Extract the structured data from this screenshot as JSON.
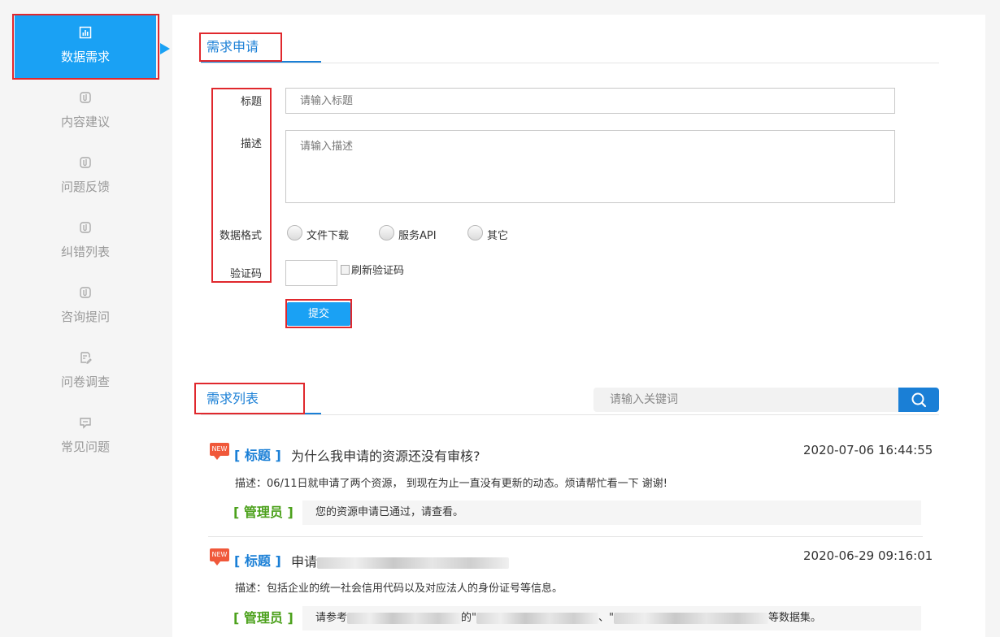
{
  "sidebar": {
    "items": [
      {
        "label": "数据需求",
        "icon": "bar-chart-icon",
        "active": true
      },
      {
        "label": "内容建议",
        "icon": "clip-icon"
      },
      {
        "label": "问题反馈",
        "icon": "clip-icon"
      },
      {
        "label": "纠错列表",
        "icon": "clip-icon"
      },
      {
        "label": "咨询提问",
        "icon": "clip-icon"
      },
      {
        "label": "问卷调查",
        "icon": "edit-doc-icon"
      },
      {
        "label": "常见问题",
        "icon": "message-icon"
      }
    ]
  },
  "form": {
    "section_title": "需求申请",
    "title_label": "标题",
    "title_placeholder": "请输入标题",
    "desc_label": "描述",
    "desc_placeholder": "请输入描述",
    "format_label": "数据格式",
    "format_options": [
      "文件下载",
      "服务API",
      "其它"
    ],
    "captcha_label": "验证码",
    "captcha_alt": "刷新验证码",
    "submit_label": "提交"
  },
  "list": {
    "section_title": "需求列表",
    "search_placeholder": "请输入关键词",
    "items": [
      {
        "badge": "NEW",
        "tag": "[ 标题 ]",
        "title": "为什么我申请的资源还没有审核?",
        "time": "2020-07-06 16:44:55",
        "desc": "描述：06/11日就申请了两个资源， 到现在为止一直没有更新的动态。烦请帮忙看一下 谢谢!",
        "admin_tag": "[ 管理员 ]",
        "reply": "您的资源申请已通过，请查看。"
      },
      {
        "badge": "NEW",
        "tag": "[ 标题 ]",
        "title": "申请",
        "time": "2020-06-29 09:16:01",
        "desc": "描述：包括企业的统一社会信用代码以及对应法人的身份证号等信息。",
        "admin_tag": "[ 管理员 ]",
        "reply_prefix": "请参考",
        "reply_mid1": "的\"",
        "reply_mid2": "、\"",
        "reply_suffix": "等数据集。"
      }
    ]
  },
  "colors": {
    "accent": "#1aa1f4",
    "link": "#1a7fd6",
    "admin": "#4ca11c",
    "highlight": "#e0282d"
  }
}
